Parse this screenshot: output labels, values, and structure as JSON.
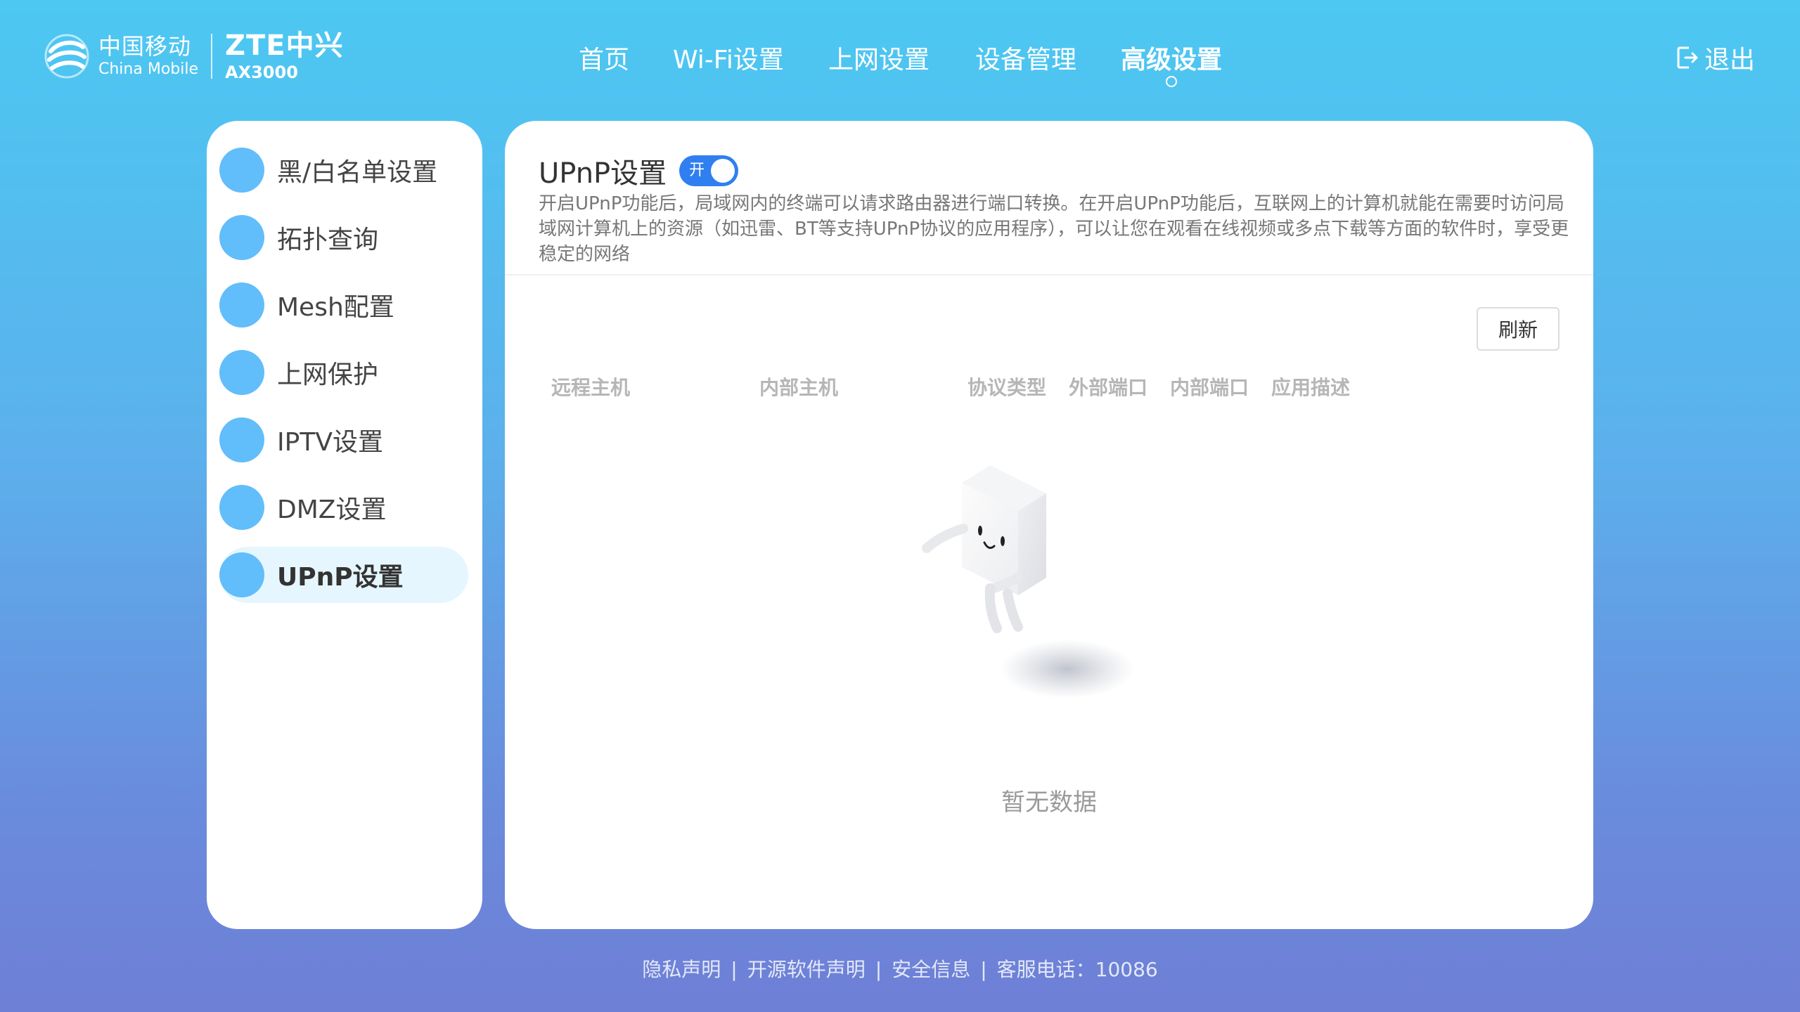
{
  "header": {
    "logo_cn": "中国移动",
    "logo_en": "China Mobile",
    "brand": "ZTE中兴",
    "model": "AX3000",
    "nav": [
      {
        "label": "首页",
        "active": false
      },
      {
        "label": "Wi-Fi设置",
        "active": false
      },
      {
        "label": "上网设置",
        "active": false
      },
      {
        "label": "设备管理",
        "active": false
      },
      {
        "label": "高级设置",
        "active": true
      }
    ],
    "logout_label": "退出"
  },
  "sidebar": {
    "items": [
      {
        "label": "黑/白名单设置",
        "active": false
      },
      {
        "label": "拓扑查询",
        "active": false
      },
      {
        "label": "Mesh配置",
        "active": false
      },
      {
        "label": "上网保护",
        "active": false
      },
      {
        "label": "IPTV设置",
        "active": false
      },
      {
        "label": "DMZ设置",
        "active": false
      },
      {
        "label": "UPnP设置",
        "active": true
      }
    ]
  },
  "main": {
    "title": "UPnP设置",
    "toggle": {
      "label": "开",
      "on": true
    },
    "description": "开启UPnP功能后，局域网内的终端可以请求路由器进行端口转换。在开启UPnP功能后，互联网上的计算机就能在需要时访问局域网计算机上的资源（如迅雷、BT等支持UPnP协议的应用程序），可以让您在观看在线视频或多点下载等方面的软件时，享受更稳定的网络",
    "refresh_label": "刷新",
    "columns": [
      "远程主机",
      "内部主机",
      "协议类型",
      "外部端口",
      "内部端口",
      "应用描述"
    ],
    "rows": [],
    "empty_text": "暂无数据"
  },
  "footer": {
    "privacy": "隐私声明",
    "opensource": "开源软件声明",
    "security": "安全信息",
    "hotline": "客服电话：10086",
    "separator": "|"
  },
  "colors": {
    "accent": "#2f7ff0",
    "menu_dot": "#62bdfb",
    "menu_active_bg": "#e6f6fe",
    "bg_top": "#4cc8f2",
    "bg_bottom": "#6e7fd6"
  }
}
